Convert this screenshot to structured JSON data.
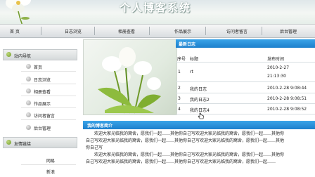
{
  "header": {
    "site_title": "个人博客系统"
  },
  "nav": {
    "items": [
      "首 页",
      "日志浏览",
      "相册查看",
      "作品展示",
      "访问者留言",
      "后台管理"
    ]
  },
  "sidebar": {
    "nav_title": "站内导航",
    "links": [
      "首页",
      "日志浏览",
      "相册查看",
      "作品展示",
      "访问者留言",
      "后台管理"
    ],
    "friend_title": "友情链接",
    "friend_links": [
      "网易",
      "新浪"
    ]
  },
  "latest": {
    "title": "最新日志",
    "columns": [
      "序号",
      "标题",
      "发布时间"
    ],
    "rows": [
      {
        "no": "1",
        "title": "rt",
        "time": "2010-2-27",
        "time2": "21:13:30"
      },
      {
        "no": "2",
        "title": "我的日志",
        "time": "2010-2-28 9:08:44"
      },
      {
        "no": "3",
        "title": "我的日志2",
        "time": "2010-2-28 9:08:51"
      },
      {
        "no": "4",
        "title": "我的日志4",
        "time": "2010-2-28 9:08:52"
      }
    ]
  },
  "intro": {
    "title": "我的博客简介",
    "lines": [
      "欢迎大家光临我的窝舍，愿我们一起……其他你自己写欢迎大家光临我的窝舍，愿我们一起……其他你",
      "自己写欢迎大家光临我的窝舍，愿我们一起……其他你自己写欢迎大家光临我的窝舍，愿我们一起……其他",
      "你自己写",
      "欢迎大家光临我的窝舍，愿我们一起……其他你自己写欢迎大家光临我的窝舍，愿我们一起……其他你",
      "自己写欢迎大家光临我的窝舍，愿我们一起……其他你自己写欢迎大家光临我的窝舍，愿我们一起……"
    ]
  },
  "colors": {
    "accent_blue": "#1c7fcc",
    "nav_bg": "#d9dde0"
  }
}
